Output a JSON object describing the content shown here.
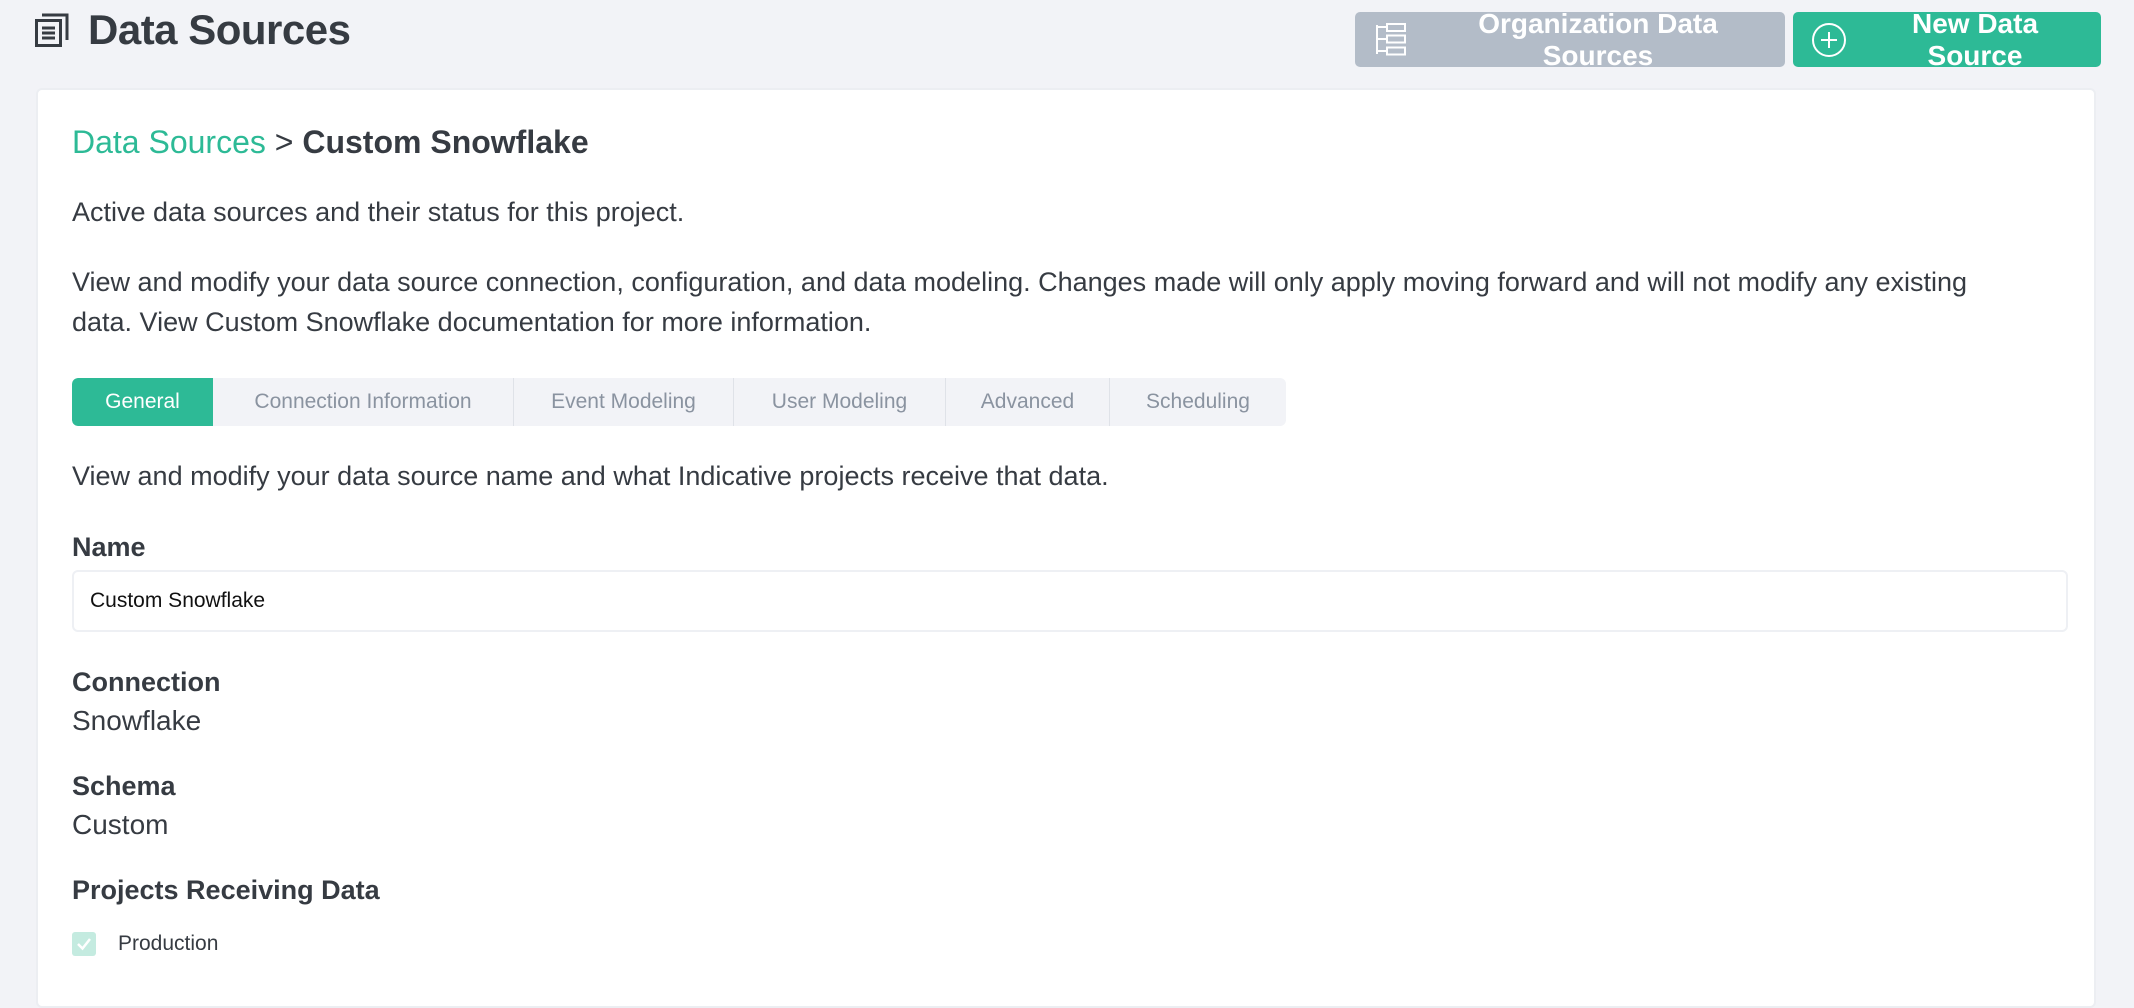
{
  "header": {
    "title": "Data Sources",
    "title_icon": "documents-icon",
    "org_button": {
      "label": "Organization Data Sources",
      "icon": "hierarchy-icon"
    },
    "new_button": {
      "label": "New Data Source",
      "icon": "plus-circle-icon"
    }
  },
  "colors": {
    "accent": "#2dba96",
    "muted_button": "#b3bcc8",
    "text": "#363b42",
    "tab_inactive_text": "#8a93a0",
    "checkbox_disabled": "#c4ebe0",
    "background": "#f2f3f7"
  },
  "breadcrumb": {
    "link": "Data Sources",
    "separator": ">",
    "current": "Custom Snowflake"
  },
  "intro": "Active data sources and their status for this project.",
  "description": "View and modify your data source connection, configuration, and data modeling. Changes made will only apply moving forward and will not modify any existing data. View Custom Snowflake documentation for more information.",
  "tabs": [
    {
      "label": "General",
      "active": true
    },
    {
      "label": "Connection Information",
      "active": false
    },
    {
      "label": "Event Modeling",
      "active": false
    },
    {
      "label": "User Modeling",
      "active": false
    },
    {
      "label": "Advanced",
      "active": false
    },
    {
      "label": "Scheduling",
      "active": false
    }
  ],
  "general": {
    "description": "View and modify your data source name and what Indicative projects receive that data.",
    "name": {
      "label": "Name",
      "value": "Custom Snowflake"
    },
    "connection": {
      "label": "Connection",
      "value": "Snowflake"
    },
    "schema": {
      "label": "Schema",
      "value": "Custom"
    },
    "projects": {
      "label": "Projects Receiving Data",
      "items": [
        {
          "label": "Production",
          "checked": true,
          "disabled": true
        }
      ]
    }
  }
}
